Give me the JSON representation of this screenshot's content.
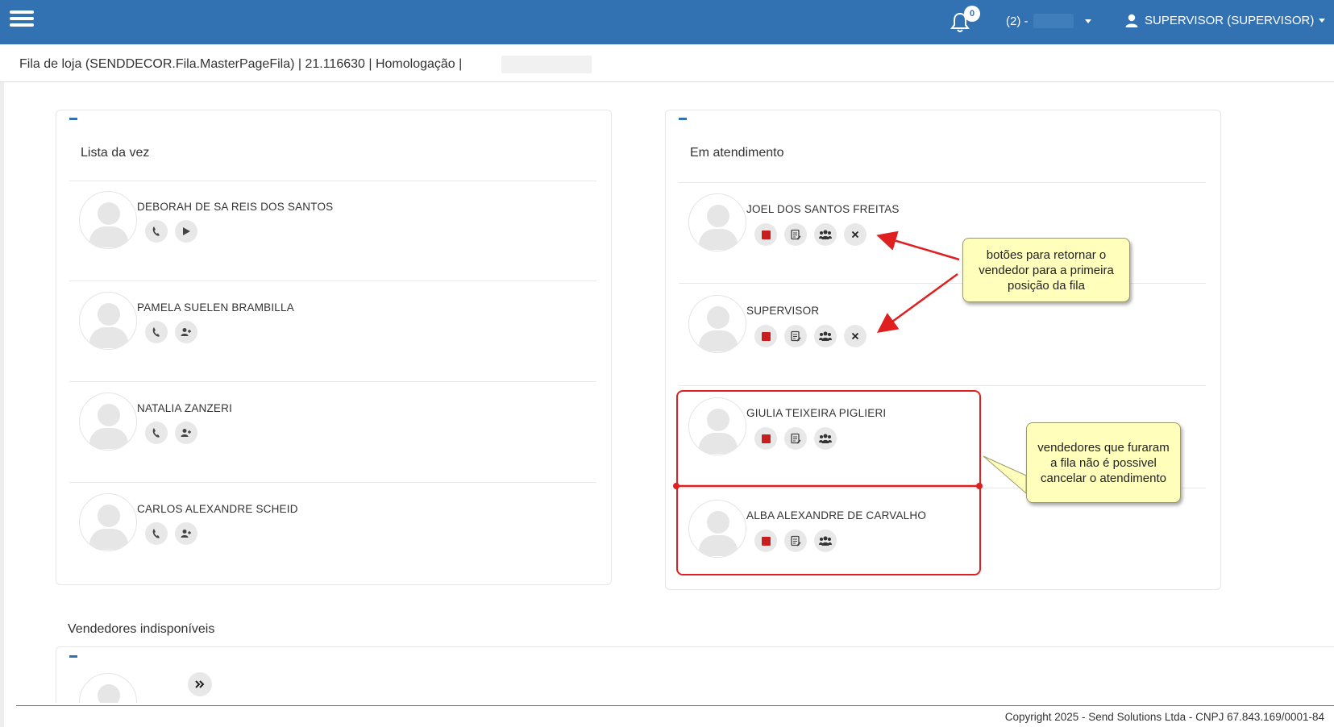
{
  "header": {
    "notification_count": "0",
    "store_selector": "(2) -",
    "user_menu": "SUPERVISOR (SUPERVISOR)"
  },
  "breadcrumb": "Fila de loja (SENDDECOR.Fila.MasterPageFila) | 21.116630 | Homologação |",
  "queue_panel": {
    "title": "Lista da vez",
    "items": [
      {
        "name": "DEBORAH DE SA REIS DOS SANTOS"
      },
      {
        "name": "PAMELA SUELEN BRAMBILLA"
      },
      {
        "name": "NATALIA ZANZERI"
      },
      {
        "name": "CARLOS ALEXANDRE SCHEID"
      }
    ]
  },
  "service_panel": {
    "title": "Em atendimento",
    "items": [
      {
        "name": "JOEL DOS SANTOS FREITAS"
      },
      {
        "name": "SUPERVISOR"
      },
      {
        "name": "GIULIA TEIXEIRA PIGLIERI"
      },
      {
        "name": "ALBA ALEXANDRE DE CARVALHO"
      }
    ]
  },
  "unavailable": {
    "title": "Vendedores indisponíveis"
  },
  "annotations": {
    "return_buttons": "botões para retornar o vendedor para a primeira posição da fila",
    "skipped_queue": "vendedores que furaram a fila não é possivel cancelar o atendimento"
  },
  "footer": "Copyright 2025 - Send Solutions Ltda - CNPJ 67.843.169/0001-84",
  "colors": {
    "topbar": "#3272b2",
    "stop_button": "#c81e1e",
    "annotation_red": "#e02020",
    "callout_fill": "#ffffbb"
  },
  "icons": [
    "menu-icon",
    "bell-icon",
    "user-icon",
    "phone-icon",
    "play-icon",
    "add-user-icon",
    "stop-icon",
    "notes-icon",
    "group-icon",
    "close-icon",
    "double-chevron-icon"
  ]
}
